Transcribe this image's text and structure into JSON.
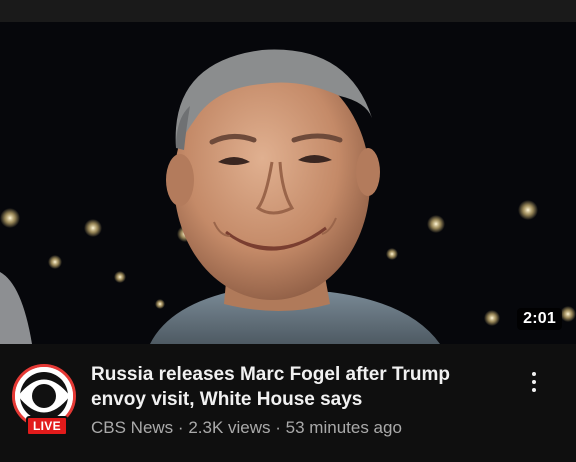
{
  "video": {
    "duration": "2:01",
    "title": "Russia releases Marc Fogel after Trump envoy visit, White House says",
    "channel": "CBS News",
    "separator": "·",
    "views": "2.3K views",
    "age": "53 minutes ago"
  },
  "channel_avatar": {
    "live_label": "LIVE",
    "icon": "cbs-eye-logo"
  },
  "menu": {
    "icon": "more-vertical-icon"
  },
  "colors": {
    "background": "#0f0f0f",
    "live_red": "#e21b1b",
    "meta_text": "#aaaaaa",
    "title_text": "#f1f1f1"
  }
}
